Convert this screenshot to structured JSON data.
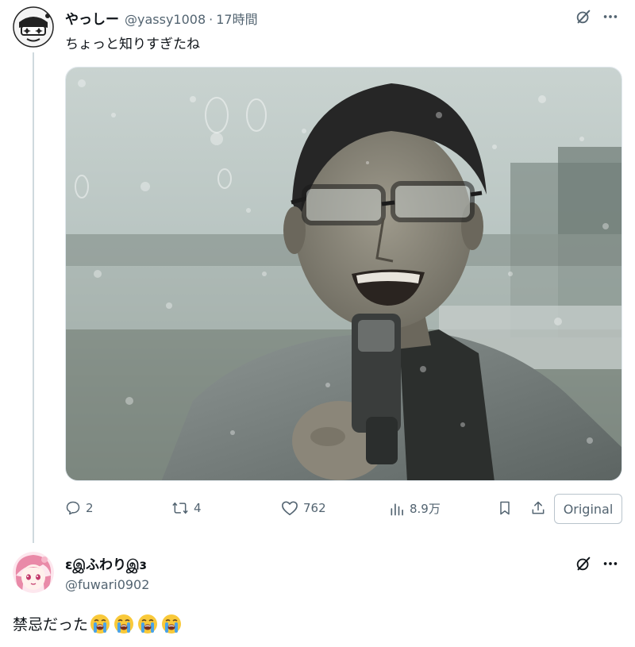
{
  "tweet1": {
    "display_name": "やっしー",
    "handle": "@yassy1008",
    "separator": "·",
    "time": "17時間",
    "text": "ちょっと知りすぎたね",
    "media_icon": "photo",
    "actions": {
      "replies": "2",
      "retweets": "4",
      "likes": "762",
      "views": "8.9万",
      "original_label": "Original"
    }
  },
  "tweet2": {
    "display_name": "ɛஇふわりஇɜ",
    "handle": "@fuwari0902",
    "text": "禁忌だった",
    "emoji_count": 4,
    "emoji": "loudly-crying-face"
  },
  "colors": {
    "text": "#0f1419",
    "secondary": "#536471",
    "thread_line": "#cfd9de"
  }
}
